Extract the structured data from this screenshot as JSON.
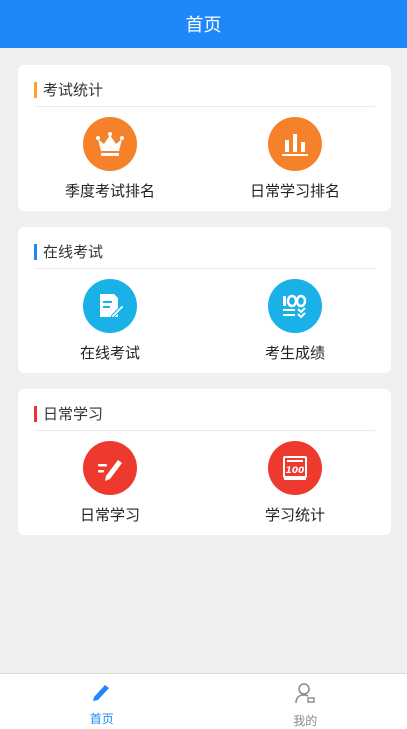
{
  "header": {
    "title": "首页"
  },
  "sections": [
    {
      "title": "考试统计",
      "bar_color": "#f5a623",
      "items": [
        {
          "label": "季度考试排名",
          "icon": "crown-icon",
          "color": "#f5822a"
        },
        {
          "label": "日常学习排名",
          "icon": "bar-chart-icon",
          "color": "#f5822a"
        }
      ]
    },
    {
      "title": "在线考试",
      "bar_color": "#1e88fb",
      "items": [
        {
          "label": "在线考试",
          "icon": "exam-edit-icon",
          "color": "#1ab0e8"
        },
        {
          "label": "考生成绩",
          "icon": "score-100-icon",
          "color": "#1ab0e8"
        }
      ]
    },
    {
      "title": "日常学习",
      "bar_color": "#e8382c",
      "items": [
        {
          "label": "日常学习",
          "icon": "pencil-icon",
          "color": "#ee3a2e"
        },
        {
          "label": "学习统计",
          "icon": "stats-100-icon",
          "color": "#ee3a2e"
        }
      ]
    }
  ],
  "tabbar": {
    "items": [
      {
        "label": "首页",
        "icon": "pencil-tab-icon",
        "active": true
      },
      {
        "label": "我的",
        "icon": "user-icon",
        "active": false
      }
    ],
    "active_color": "#1e88fb",
    "inactive_color": "#8a8a8a"
  }
}
